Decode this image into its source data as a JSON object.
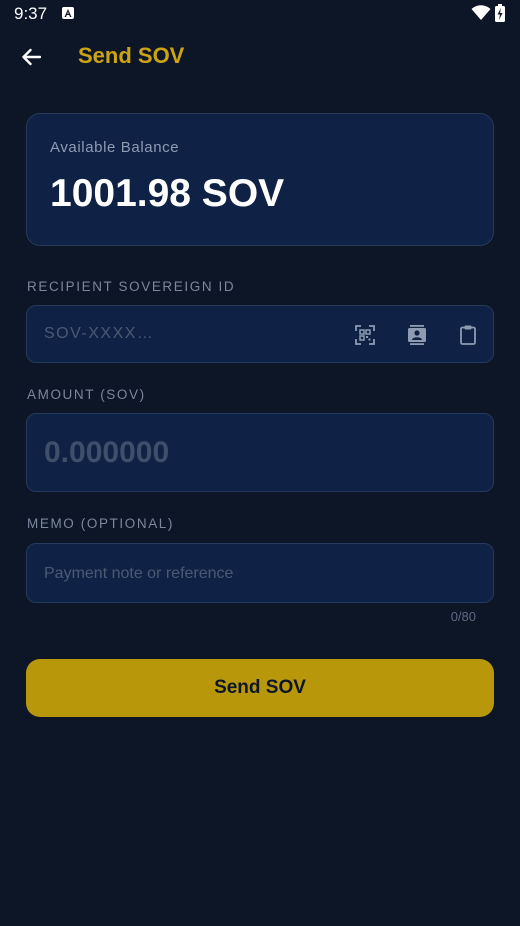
{
  "status_bar": {
    "time": "9:37"
  },
  "app_bar": {
    "title": "Send SOV"
  },
  "balance": {
    "label": "Available Balance",
    "value": "1001.98 SOV"
  },
  "recipient": {
    "label": "RECIPIENT SOVEREIGN ID",
    "placeholder": "SOV-XXXX…"
  },
  "amount": {
    "label": "AMOUNT (SOV)",
    "placeholder": "0.000000"
  },
  "memo": {
    "label": "MEMO (OPTIONAL)",
    "placeholder": "Payment note or reference",
    "counter": "0/80"
  },
  "send_button": {
    "label": "Send SOV"
  },
  "colors": {
    "background": "#0d1627",
    "card": "#0f2245",
    "accent": "#cca314",
    "button": "#b8970b"
  }
}
